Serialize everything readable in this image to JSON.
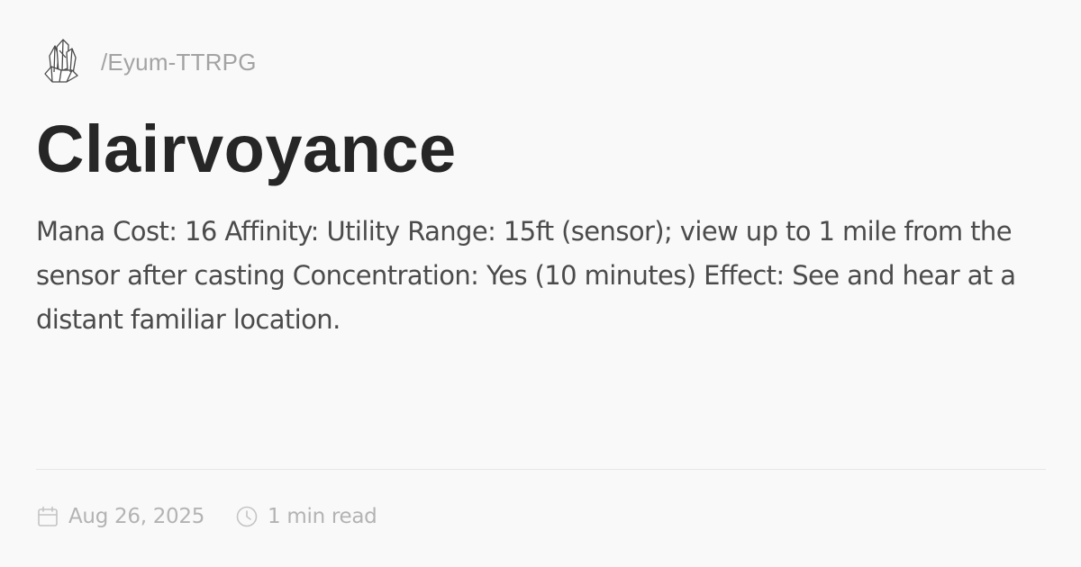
{
  "site": {
    "logo_icon": "crystal-cluster-icon",
    "path": "/Eyum-TTRPG"
  },
  "article": {
    "title": "Clairvoyance",
    "description": "Mana Cost: 16 Affinity: Utility Range: 15ft (sensor); view up to 1 mile from the sensor after casting Concentration: Yes (10 minutes) Effect: See and hear at a distant familiar location."
  },
  "meta": {
    "date_icon": "calendar-icon",
    "date": "Aug 26, 2025",
    "read_icon": "clock-icon",
    "read_time": "1 min read"
  },
  "colors": {
    "background": "#f9f9f9",
    "title": "#262626",
    "body_text": "#4b4b4b",
    "muted": "#b3b3b3"
  }
}
